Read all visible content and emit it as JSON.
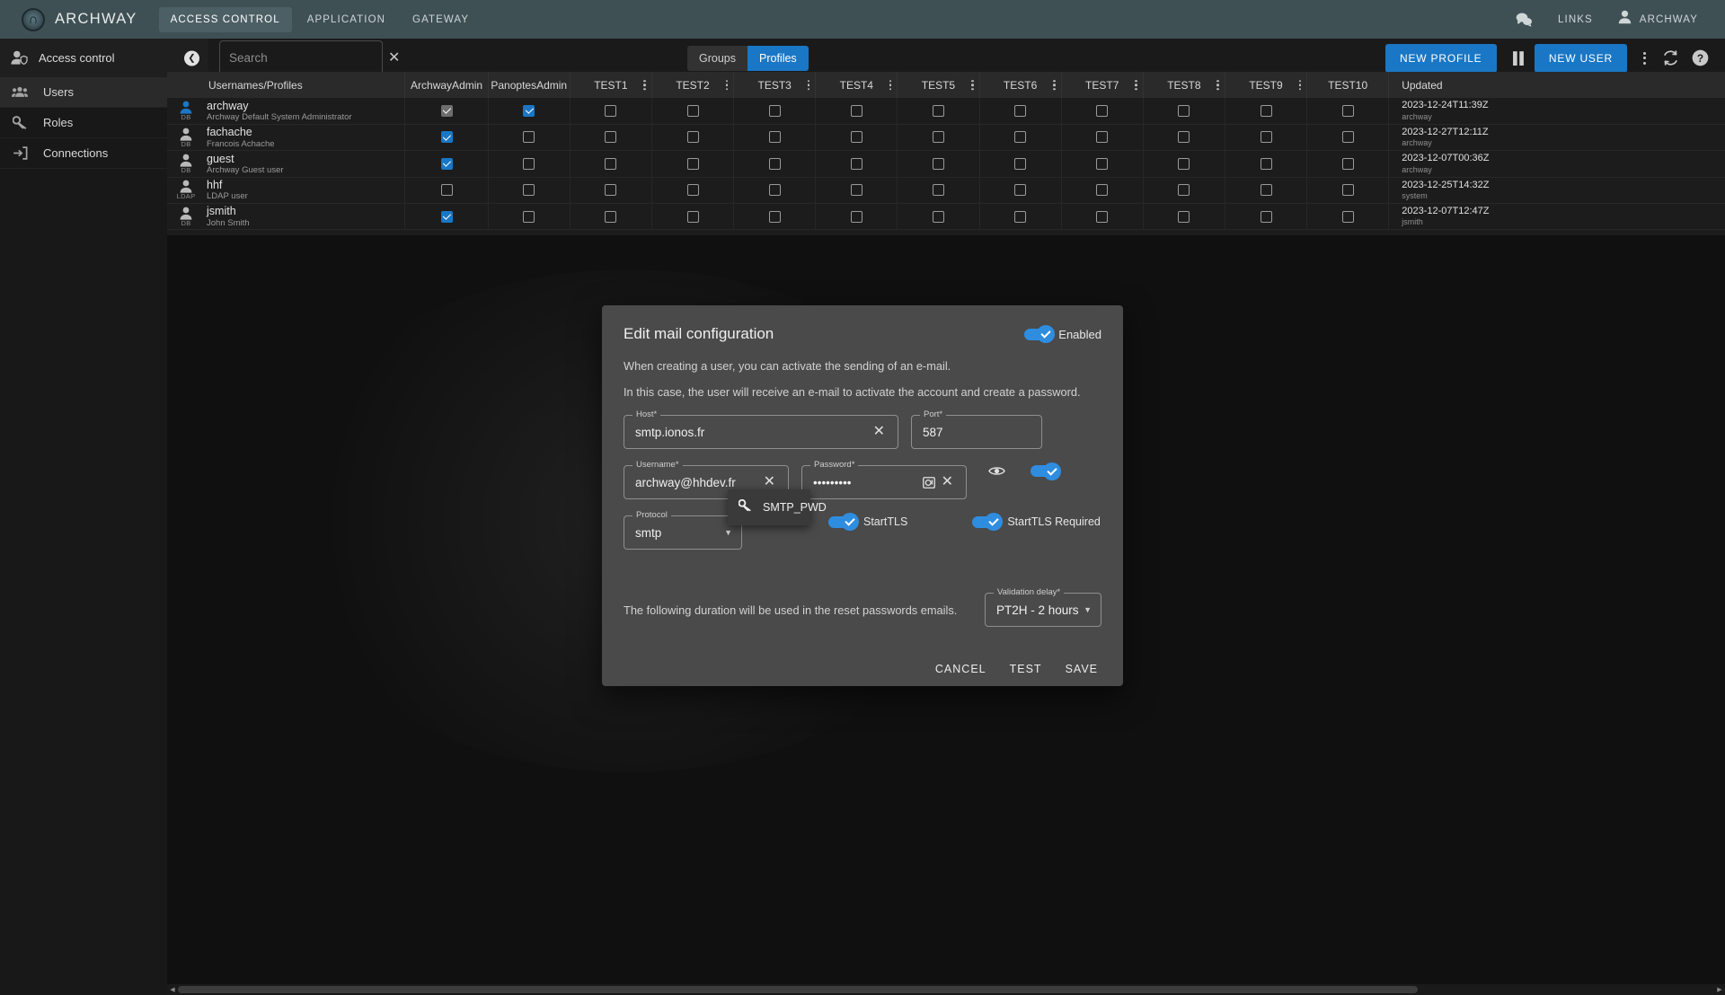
{
  "header": {
    "brand": "ARCHWAY",
    "nav": [
      {
        "label": "ACCESS CONTROL",
        "active": true
      },
      {
        "label": "APPLICATION",
        "active": false
      },
      {
        "label": "GATEWAY",
        "active": false
      }
    ],
    "chat_icon": "chat-bubbles-icon",
    "links_label": "LINKS",
    "user_icon": "person-icon",
    "user_label": "ARCHWAY"
  },
  "toolbar": {
    "section_icon": "access-control-icon",
    "section_title": "Access control",
    "collapse_icon": "chevron-left-icon",
    "search": {
      "value": "",
      "placeholder": "Search",
      "clear_icon": "close-icon"
    },
    "segments": [
      {
        "label": "Groups",
        "active": false
      },
      {
        "label": "Profiles",
        "active": true
      }
    ],
    "new_profile_label": "NEW PROFILE",
    "pause_icon": "pause-icon",
    "new_user_label": "NEW USER",
    "overflow_icon": "kebab-menu-icon",
    "refresh_icon": "refresh-icon",
    "help_icon": "help-icon"
  },
  "sidebar": {
    "items": [
      {
        "label": "Users",
        "icon": "users-icon",
        "active": true
      },
      {
        "label": "Roles",
        "icon": "key-icon",
        "active": false
      },
      {
        "label": "Connections",
        "icon": "connections-icon",
        "active": false
      }
    ]
  },
  "table": {
    "columns": [
      "Usernames/Profiles",
      "ArchwayAdmin",
      "PanoptesAdmin",
      "TEST1",
      "TEST2",
      "TEST3",
      "TEST4",
      "TEST5",
      "TEST6",
      "TEST7",
      "TEST8",
      "TEST9",
      "TEST10",
      "Updated"
    ],
    "rows": [
      {
        "username": "archway",
        "description": "Archway Default System Administrator",
        "source": "DB",
        "avatar": "person-icon-blue",
        "checks": [
          "disabled",
          false,
          false,
          false,
          false,
          false,
          false,
          false,
          false,
          false,
          false,
          false
        ],
        "archway_admin": "disabled",
        "panoptes_admin": true,
        "updated_at": "2023-12-24T11:39Z",
        "updated_by": "archway"
      },
      {
        "username": "fachache",
        "description": "Francois Achache",
        "source": "DB",
        "avatar": "person-icon",
        "archway_admin": true,
        "panoptes_admin": false,
        "updated_at": "2023-12-27T12:11Z",
        "updated_by": "archway"
      },
      {
        "username": "guest",
        "description": "Archway Guest user",
        "source": "DB",
        "avatar": "person-icon",
        "archway_admin": true,
        "panoptes_admin": false,
        "updated_at": "2023-12-07T00:36Z",
        "updated_by": "archway"
      },
      {
        "username": "hhf",
        "description": "LDAP user",
        "source": "LDAP",
        "avatar": "person-icon",
        "archway_admin": false,
        "panoptes_admin": false,
        "updated_at": "2023-12-25T14:32Z",
        "updated_by": "system"
      },
      {
        "username": "jsmith",
        "description": "John Smith",
        "source": "DB",
        "avatar": "person-icon",
        "archway_admin": true,
        "panoptes_admin": false,
        "updated_at": "2023-12-07T12:47Z",
        "updated_by": "jsmith"
      }
    ]
  },
  "dialog": {
    "title": "Edit mail configuration",
    "enabled_label": "Enabled",
    "paragraph1": "When creating a user, you can activate the sending of an e-mail.",
    "paragraph2": "In this case, the user will receive an e-mail to activate the account and create a password.",
    "fields": {
      "host": {
        "label": "Host*",
        "value": "smtp.ionos.fr",
        "clear_icon": "close-icon"
      },
      "port": {
        "label": "Port*",
        "value": "587"
      },
      "username": {
        "label": "Username*",
        "value": "archway@hhdev.fr",
        "clear_icon": "close-icon"
      },
      "password": {
        "label": "Password*",
        "value": "•••••••••",
        "vault_icon": "vault-icon",
        "clear_icon": "close-icon",
        "reveal_icon": "eye-icon"
      },
      "protocol": {
        "label": "Protocol",
        "value": "smtp",
        "caret_icon": "chevron-down-icon"
      },
      "validation_delay": {
        "label": "Validation delay*",
        "value": "PT2H - 2 hours",
        "caret_icon": "chevron-down-icon"
      }
    },
    "switches": [
      {
        "label": "StartTLS",
        "on": true
      },
      {
        "label": "StartTLS Required",
        "on": true
      }
    ],
    "password_toggle_on": true,
    "autofill": {
      "icon": "key-icon",
      "label": "SMTP_PWD"
    },
    "bottom_text": "The following duration will be used in the reset passwords emails.",
    "actions": [
      {
        "label": "CANCEL"
      },
      {
        "label": "TEST"
      },
      {
        "label": "SAVE"
      }
    ]
  },
  "colors": {
    "accent": "#1a77c5",
    "header_bg": "#3f5055",
    "dialog_bg": "#4a4a4a",
    "page_bg": "#101010"
  }
}
